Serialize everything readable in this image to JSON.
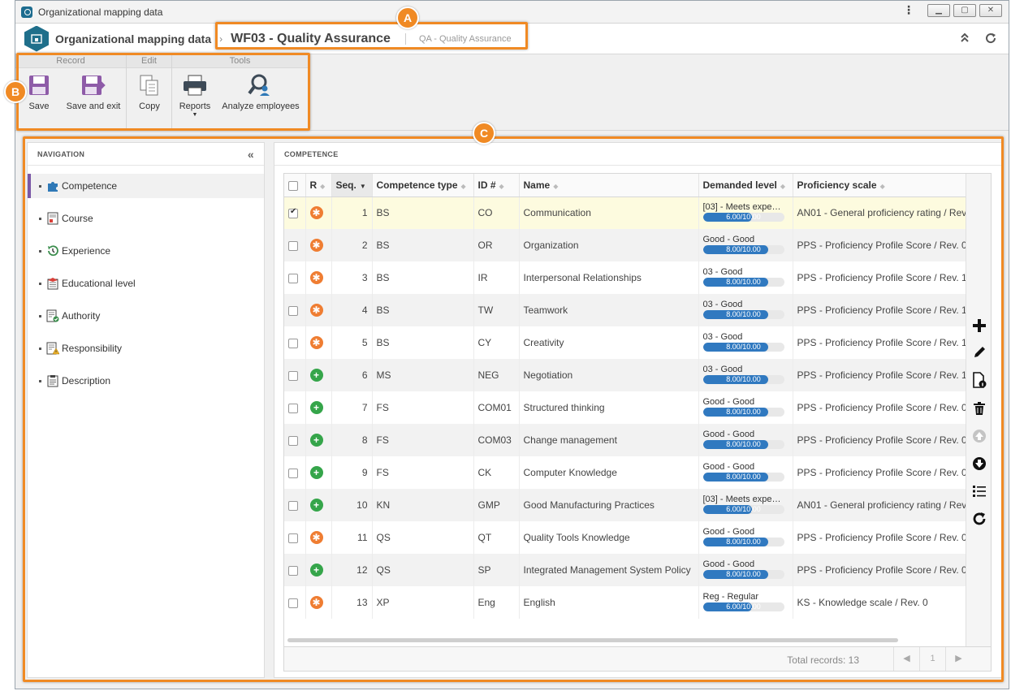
{
  "window": {
    "title": "Organizational mapping data"
  },
  "header": {
    "breadcrumb": "Organizational mapping data",
    "record_title": "WF03 - Quality Assurance",
    "record_subtitle": "QA - Quality Assurance"
  },
  "annotations": {
    "a": "A",
    "b": "B",
    "c": "C"
  },
  "ribbon": {
    "groups": {
      "record": "Record",
      "edit": "Edit",
      "tools": "Tools"
    },
    "buttons": {
      "save": "Save",
      "save_exit": "Save and exit",
      "copy": "Copy",
      "reports": "Reports",
      "analyze": "Analyze employees"
    }
  },
  "navigation": {
    "title": "NAVIGATION",
    "items": [
      {
        "label": "Competence",
        "icon": "puzzle-icon"
      },
      {
        "label": "Course",
        "icon": "course-icon"
      },
      {
        "label": "Experience",
        "icon": "history-icon"
      },
      {
        "label": "Educational level",
        "icon": "education-icon"
      },
      {
        "label": "Authority",
        "icon": "authority-icon"
      },
      {
        "label": "Responsibility",
        "icon": "responsibility-icon"
      },
      {
        "label": "Description",
        "icon": "description-icon"
      }
    ]
  },
  "competence": {
    "title": "COMPETENCE",
    "columns": [
      "R",
      "Seq.",
      "Competence type",
      "ID #",
      "Name",
      "Demanded level",
      "Proficiency scale"
    ],
    "rows": [
      {
        "checked": true,
        "r": "required",
        "seq": "1",
        "type": "BS",
        "id": "CO",
        "name": "Communication",
        "level": "[03] - Meets expe…",
        "bar": "6.00/10.00",
        "fill": 0.6,
        "scale": "AN01 - General proficiency rating / Rev"
      },
      {
        "checked": false,
        "r": "required",
        "seq": "2",
        "type": "BS",
        "id": "OR",
        "name": "Organization",
        "level": "Good - Good",
        "bar": "8.00/10.00",
        "fill": 0.8,
        "scale": "PPS - Proficiency Profile Score / Rev. 0"
      },
      {
        "checked": false,
        "r": "required",
        "seq": "3",
        "type": "BS",
        "id": "IR",
        "name": "Interpersonal Relationships",
        "level": "03 - Good",
        "bar": "8.00/10.00",
        "fill": 0.8,
        "scale": "PPS - Proficiency Profile Score / Rev. 1"
      },
      {
        "checked": false,
        "r": "required",
        "seq": "4",
        "type": "BS",
        "id": "TW",
        "name": "Teamwork",
        "level": "03 - Good",
        "bar": "8.00/10.00",
        "fill": 0.8,
        "scale": "PPS - Proficiency Profile Score / Rev. 1"
      },
      {
        "checked": false,
        "r": "required",
        "seq": "5",
        "type": "BS",
        "id": "CY",
        "name": "Creativity",
        "level": "03 - Good",
        "bar": "8.00/10.00",
        "fill": 0.8,
        "scale": "PPS - Proficiency Profile Score / Rev. 1"
      },
      {
        "checked": false,
        "r": "optional",
        "seq": "6",
        "type": "MS",
        "id": "NEG",
        "name": "Negotiation",
        "level": "03 - Good",
        "bar": "8.00/10.00",
        "fill": 0.8,
        "scale": "PPS - Proficiency Profile Score / Rev. 1"
      },
      {
        "checked": false,
        "r": "optional",
        "seq": "7",
        "type": "FS",
        "id": "COM01",
        "name": "Structured thinking",
        "level": "Good - Good",
        "bar": "8.00/10.00",
        "fill": 0.8,
        "scale": "PPS - Proficiency Profile Score / Rev. 0"
      },
      {
        "checked": false,
        "r": "optional",
        "seq": "8",
        "type": "FS",
        "id": "COM03",
        "name": "Change management",
        "level": "Good - Good",
        "bar": "8.00/10.00",
        "fill": 0.8,
        "scale": "PPS - Proficiency Profile Score / Rev. 0"
      },
      {
        "checked": false,
        "r": "optional",
        "seq": "9",
        "type": "FS",
        "id": "CK",
        "name": "Computer Knowledge",
        "level": "Good - Good",
        "bar": "8.00/10.00",
        "fill": 0.8,
        "scale": "PPS - Proficiency Profile Score / Rev. 0"
      },
      {
        "checked": false,
        "r": "optional",
        "seq": "10",
        "type": "KN",
        "id": "GMP",
        "name": "Good Manufacturing Practices",
        "level": "[03] - Meets expe…",
        "bar": "6.00/10.00",
        "fill": 0.6,
        "scale": "AN01 - General proficiency rating / Rev"
      },
      {
        "checked": false,
        "r": "required",
        "seq": "11",
        "type": "QS",
        "id": "QT",
        "name": "Quality Tools Knowledge",
        "level": "Good - Good",
        "bar": "8.00/10.00",
        "fill": 0.8,
        "scale": "PPS - Proficiency Profile Score / Rev. 0"
      },
      {
        "checked": false,
        "r": "optional",
        "seq": "12",
        "type": "QS",
        "id": "SP",
        "name": "Integrated Management System Policy",
        "level": "Good - Good",
        "bar": "8.00/10.00",
        "fill": 0.8,
        "scale": "PPS - Proficiency Profile Score / Rev. 0"
      },
      {
        "checked": false,
        "r": "required",
        "seq": "13",
        "type": "XP",
        "id": "Eng",
        "name": "English",
        "level": "Reg - Regular",
        "bar": "6.00/10.00",
        "fill": 0.6,
        "scale": "KS - Knowledge scale / Rev. 0"
      }
    ],
    "footer": {
      "total": "Total records: 13",
      "page": "1"
    }
  },
  "colors": {
    "accent": "#f08a24",
    "brand": "#1f6f8b",
    "nav_active": "#7a57a6",
    "bar": "#3079c0",
    "required": "#ef7d32",
    "optional": "#35a54a"
  }
}
